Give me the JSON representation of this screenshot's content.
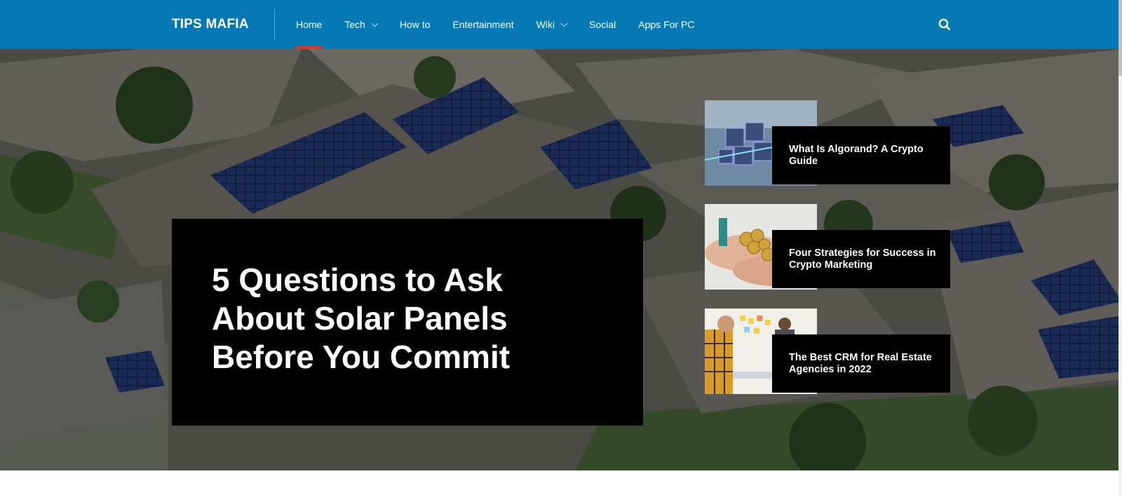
{
  "site": {
    "logo": "TIPS MAFIA",
    "brand_color": "#0679b4",
    "active_indicator_color": "#e2332a"
  },
  "nav": {
    "items": [
      {
        "label": "Home",
        "active": true,
        "has_dropdown": false
      },
      {
        "label": "Tech",
        "active": false,
        "has_dropdown": true
      },
      {
        "label": "How to",
        "active": false,
        "has_dropdown": false
      },
      {
        "label": "Entertainment",
        "active": false,
        "has_dropdown": false
      },
      {
        "label": "Wiki",
        "active": false,
        "has_dropdown": true
      },
      {
        "label": "Social",
        "active": false,
        "has_dropdown": false
      },
      {
        "label": "Apps For PC",
        "active": false,
        "has_dropdown": false
      }
    ],
    "search_icon": "search-icon"
  },
  "hero": {
    "background": "aerial-houses-solar-panels",
    "featured": {
      "title": "5 Questions to Ask About Solar Panels Before You Commit"
    },
    "side_posts": [
      {
        "title": "What Is Algorand? A Crypto Guide",
        "thumb": "crypto-blocks-image"
      },
      {
        "title": "Four Strategies for Success in Crypto Marketing",
        "thumb": "hands-coins-image"
      },
      {
        "title": "The Best CRM for Real Estate Agencies in 2022",
        "thumb": "office-team-image"
      }
    ]
  }
}
